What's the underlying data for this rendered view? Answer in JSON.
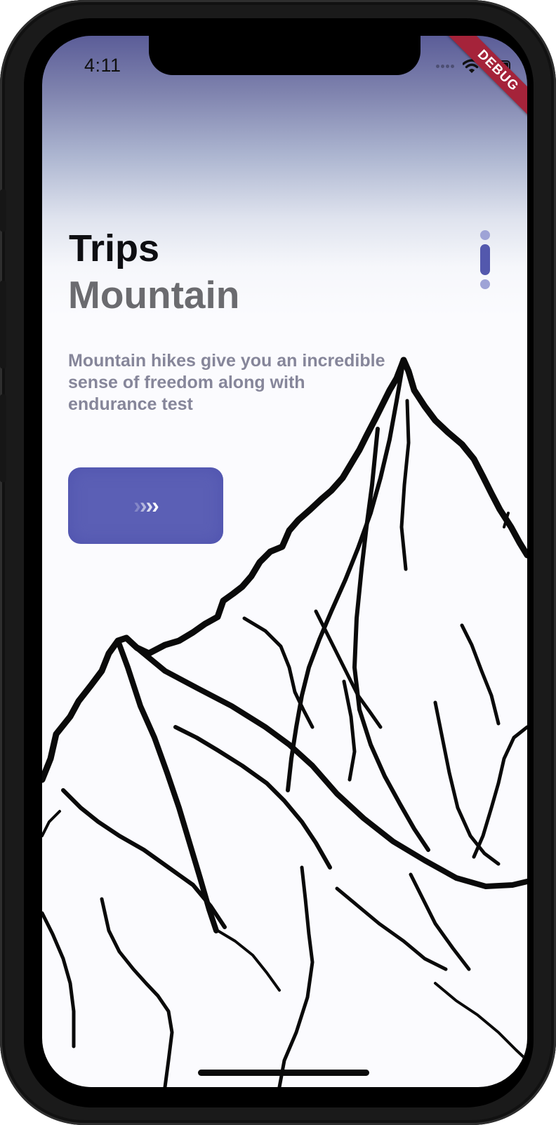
{
  "status_bar": {
    "time": "4:11",
    "icons": [
      "signal-dots-icon",
      "wifi-icon",
      "battery-icon"
    ]
  },
  "debug_banner": {
    "label": "DEBUG"
  },
  "hero": {
    "title": "Trips",
    "subtitle": "Mountain",
    "description": "Mountain hikes give you an incredible sense of freedom along with endurance test"
  },
  "go_button": {
    "icon": "chevrons-right-icon",
    "color": "#5b5fb5"
  },
  "pager": {
    "pages": 3,
    "active_index": 1,
    "active_color": "#5358ad",
    "inactive_color": "#9ea3d6"
  },
  "colors": {
    "title": "#0e0e12",
    "subtitle": "#6b6b6f",
    "description": "#86869a",
    "gradient_top": "#5b5d98",
    "background": "#fbfbfe",
    "debug": "#a5233a"
  }
}
